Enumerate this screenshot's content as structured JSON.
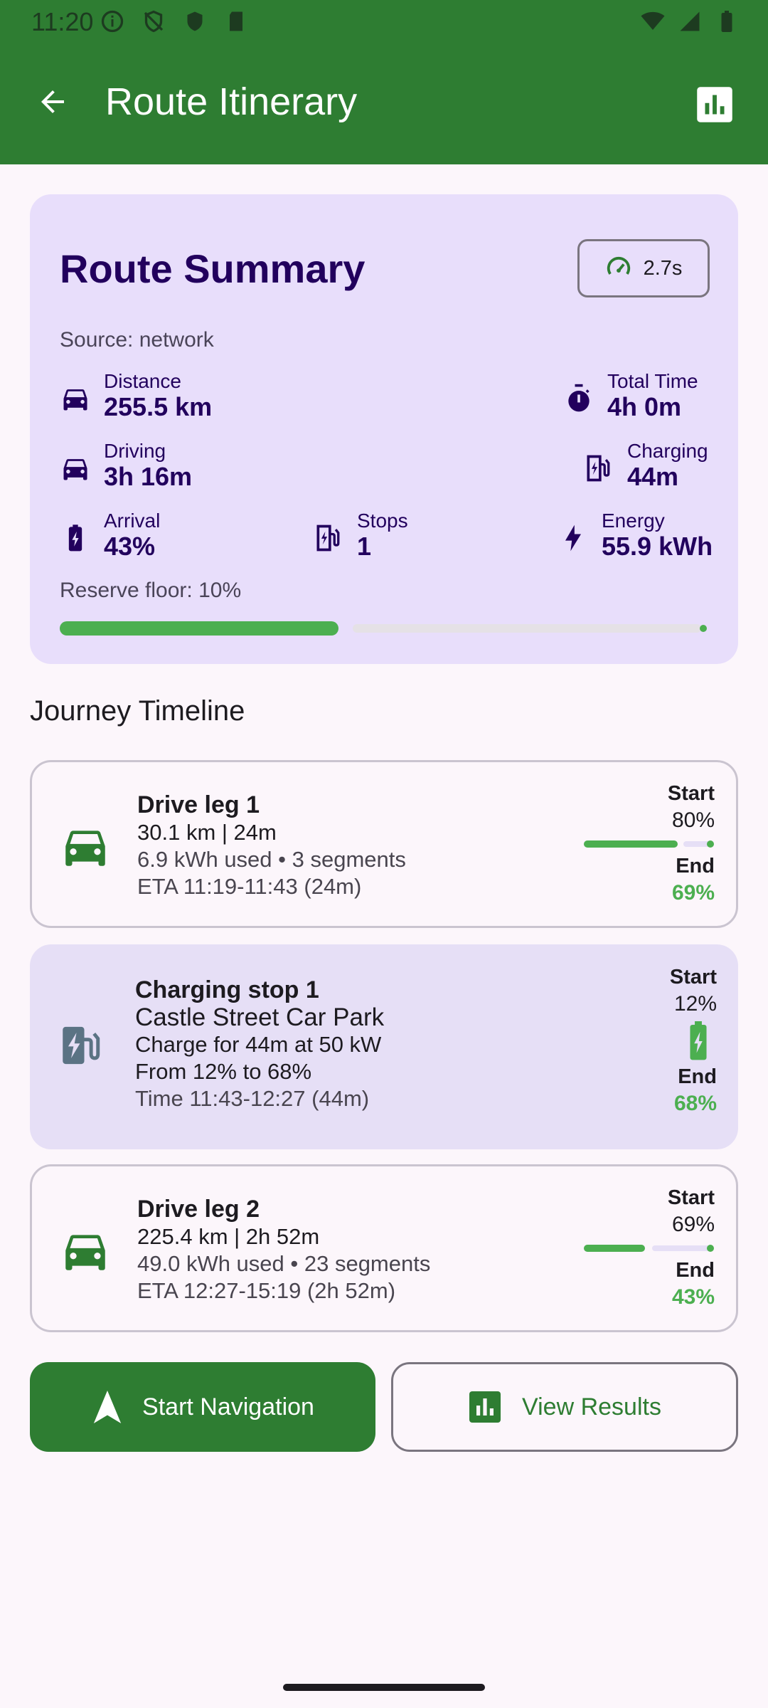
{
  "status": {
    "time": "11:20"
  },
  "appbar": {
    "title": "Route Itinerary"
  },
  "summary": {
    "title": "Route Summary",
    "compute_time": "2.7s",
    "source": "Source: network",
    "distance": {
      "label": "Distance",
      "value": "255.5 km"
    },
    "total_time": {
      "label": "Total Time",
      "value": "4h 0m"
    },
    "driving": {
      "label": "Driving",
      "value": "3h 16m"
    },
    "charging": {
      "label": "Charging",
      "value": "44m"
    },
    "arrival": {
      "label": "Arrival",
      "value": "43%"
    },
    "stops": {
      "label": "Stops",
      "value": "1"
    },
    "energy": {
      "label": "Energy",
      "value": "55.9 kWh"
    },
    "reserve": "Reserve floor: 10%",
    "arrival_fraction": 0.43
  },
  "timeline": {
    "title": "Journey Timeline",
    "items": [
      {
        "title": "Drive leg 1",
        "line1": "30.1 km  |  24m",
        "line2": "6.9 kWh used  •  3 segments",
        "line3": "ETA 11:19-11:43 (24m)",
        "start_label": "Start",
        "start_val": "80%",
        "end_label": "End",
        "end_val": "69%"
      },
      {
        "title": "Charging stop 1",
        "line1": "Castle Street Car Park",
        "line2": "Charge for 44m at 50 kW",
        "line3": "From 12% to 68%",
        "line4": "Time 11:43-12:27 (44m)",
        "start_label": "Start",
        "start_val": "12%",
        "end_label": "End",
        "end_val": "68%"
      },
      {
        "title": "Drive leg 2",
        "line1": "225.4 km  |  2h 52m",
        "line2": "49.0 kWh used  •  23 segments",
        "line3": "ETA 12:27-15:19 (2h 52m)",
        "start_label": "Start",
        "start_val": "69%",
        "end_label": "End",
        "end_val": "43%"
      }
    ]
  },
  "actions": {
    "start_navigation": "Start Navigation",
    "view_results": "View Results"
  },
  "colors": {
    "primary": "#2e7d32",
    "accent_green": "#4caf50",
    "summary_bg": "#e8defb",
    "summary_text": "#22005d"
  }
}
